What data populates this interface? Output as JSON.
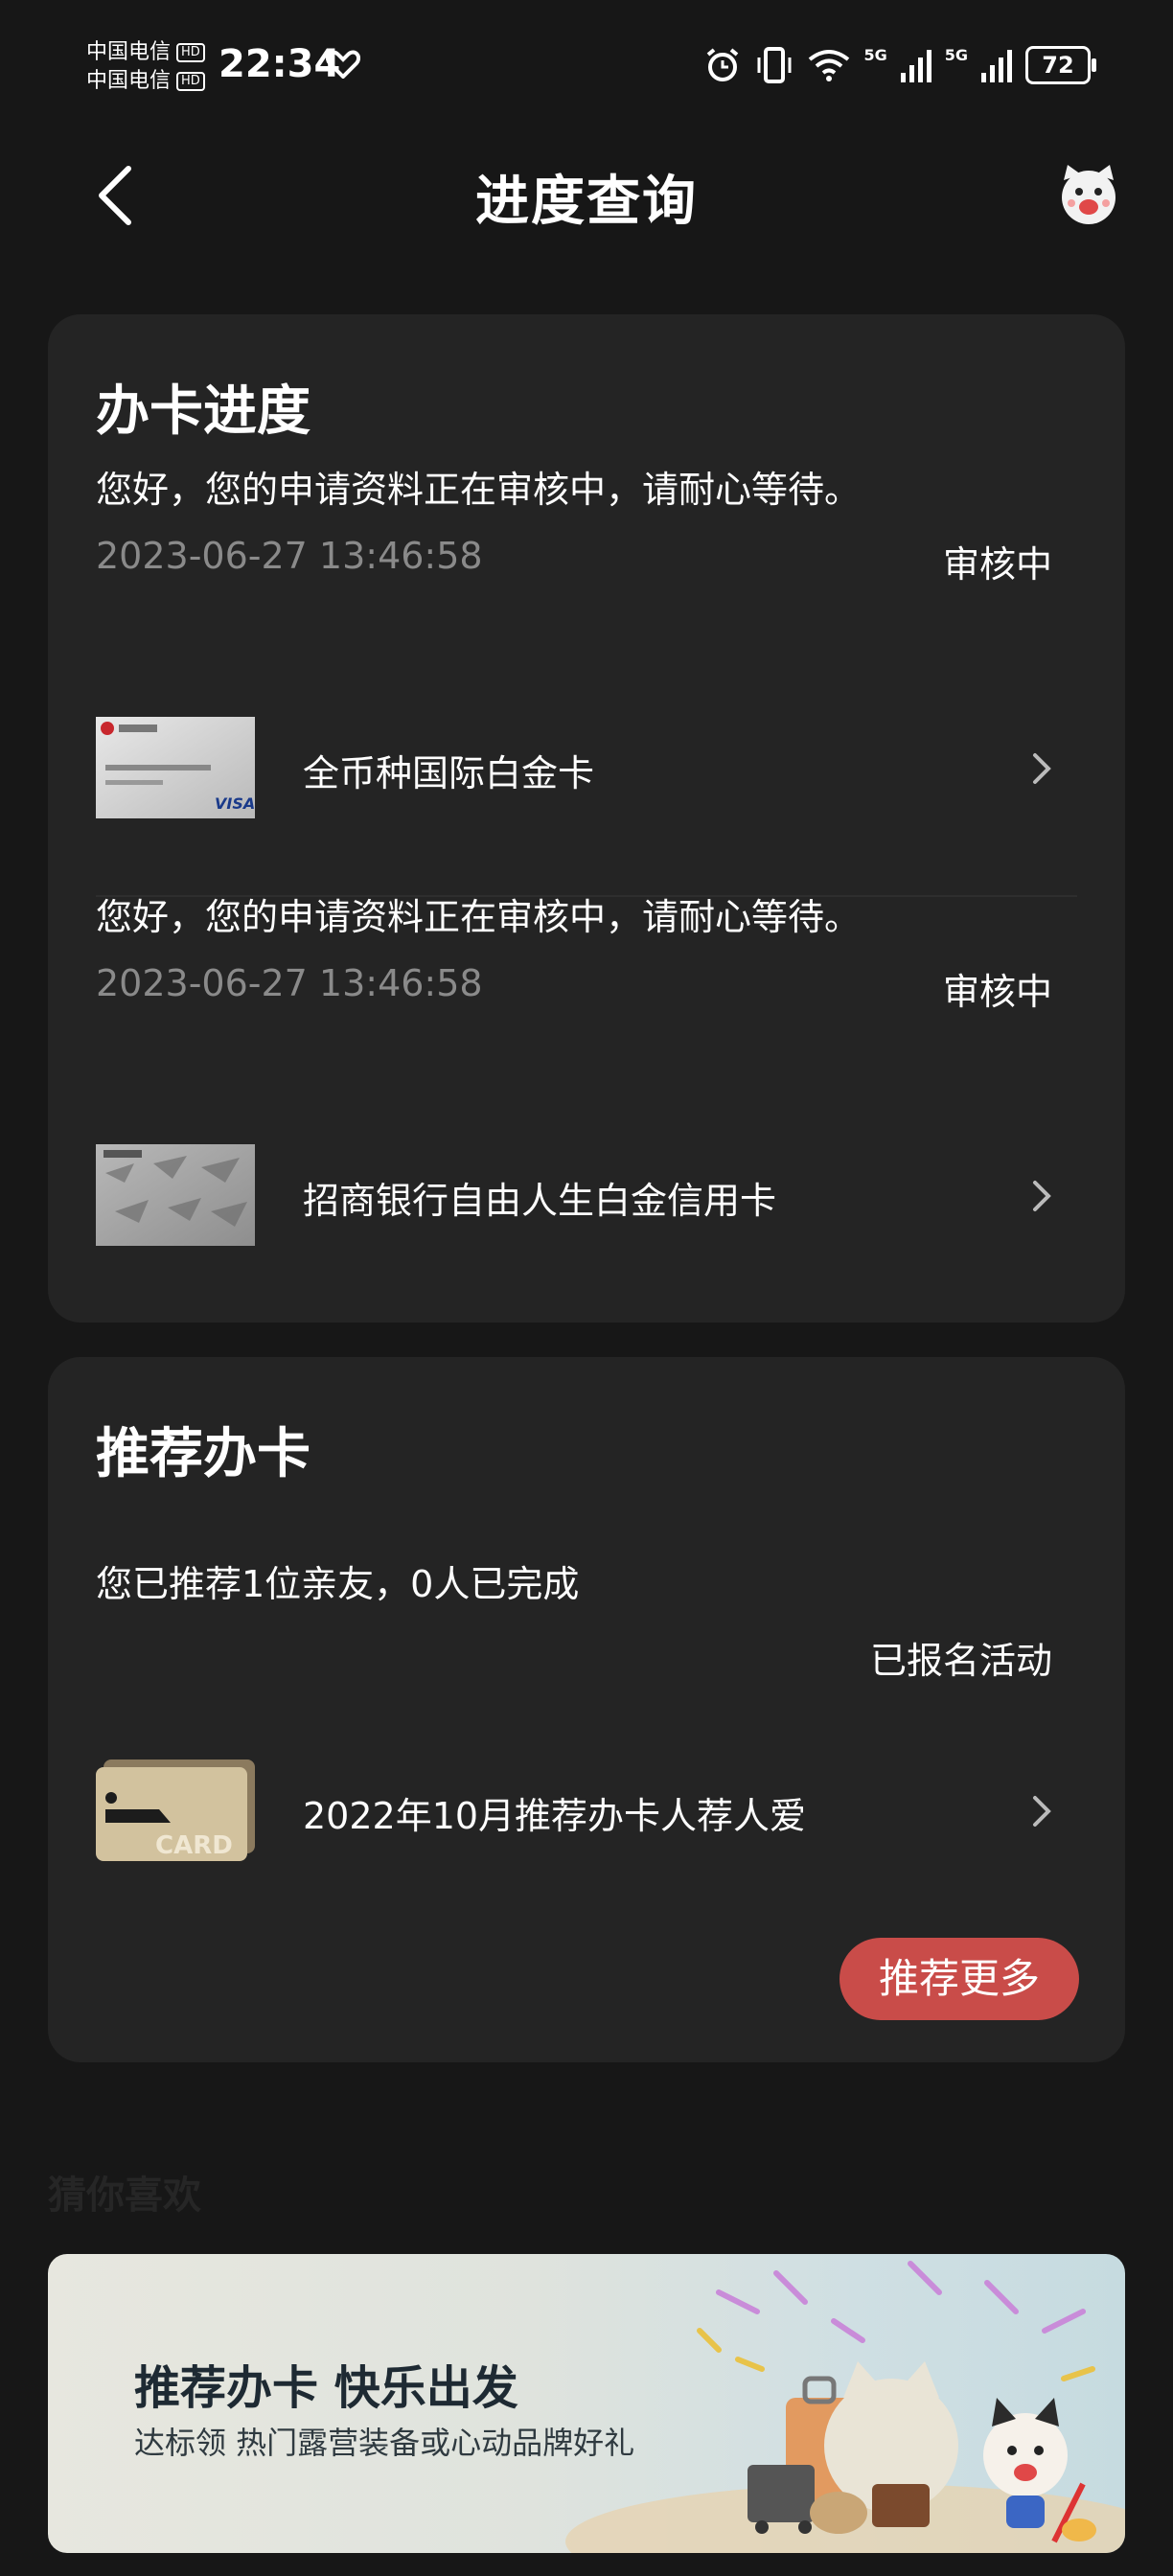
{
  "status_bar": {
    "carrier_1": "中国电信",
    "carrier_2": "中国电信",
    "hd": "HD",
    "time": "22:34",
    "signal_1": "5G",
    "signal_2": "5G",
    "battery": "72"
  },
  "header": {
    "title": "进度查询"
  },
  "progress": {
    "title": "办卡进度",
    "items": [
      {
        "message": "您好，您的申请资料正在审核中，请耐心等待。",
        "timestamp": "2023-06-27 13:46:58",
        "status": "审核中",
        "card_name": "全币种国际白金卡"
      },
      {
        "message": "您好，您的申请资料正在审核中，请耐心等待。",
        "timestamp": "2023-06-27 13:46:58",
        "status": "审核中",
        "card_name": "招商银行自由人生白金信用卡"
      }
    ]
  },
  "recommend": {
    "title": "推荐办卡",
    "summary": "您已推荐1位亲友，0人已完成",
    "status": "已报名活动",
    "activity_name": "2022年10月推荐办卡人荐人爱",
    "card_label": "CARD",
    "more_button": "推荐更多"
  },
  "guess": {
    "title": "猜你喜欢"
  },
  "banner": {
    "title": "推荐办卡  快乐出发",
    "subtitle": "达标领 热门露营装备或心动品牌好礼"
  },
  "colors": {
    "background": "#171717",
    "card": "#242424",
    "accent_button": "#c94c49",
    "muted_text": "#8a8a8a"
  }
}
